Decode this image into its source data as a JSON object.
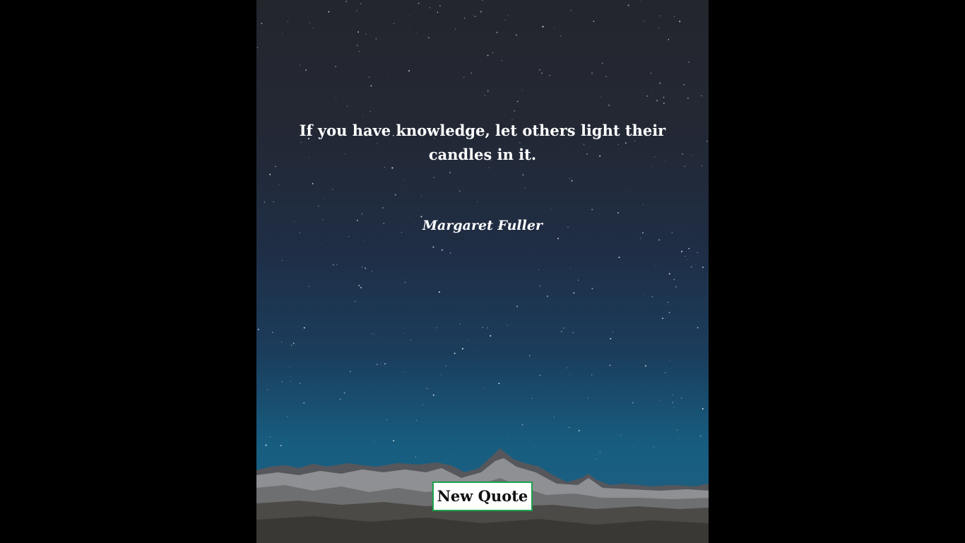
{
  "quote": {
    "text": "If you have knowledge, let others light their candles in it.",
    "author": "Margaret Fuller"
  },
  "controls": {
    "new_quote_label": "New Quote"
  },
  "colors": {
    "page_background": "#000000",
    "text": "#ffffff",
    "button_border": "#1aa34a",
    "button_background": "#ffffff"
  }
}
